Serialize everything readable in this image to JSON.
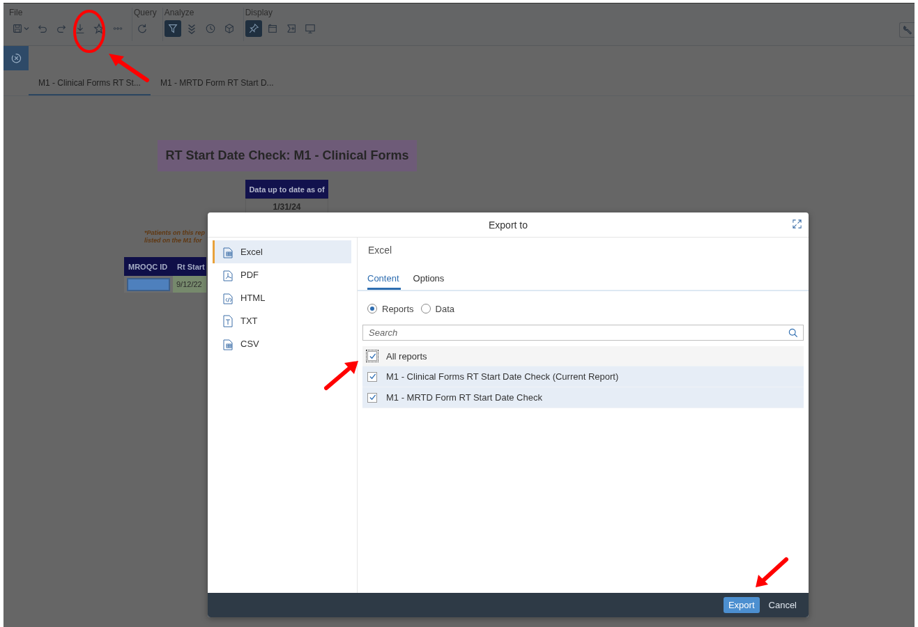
{
  "toolbar": {
    "groups": [
      {
        "label": "File",
        "buttons": [
          {
            "kind": "save",
            "on": false
          },
          {
            "kind": "undo",
            "on": false
          },
          {
            "kind": "redo",
            "on": false
          },
          {
            "kind": "download",
            "on": false
          },
          {
            "kind": "star",
            "on": false
          },
          {
            "kind": "more",
            "on": false
          }
        ]
      },
      {
        "label": "Query",
        "buttons": [
          {
            "kind": "refresh",
            "on": false
          }
        ]
      },
      {
        "label": "Analyze",
        "buttons": [
          {
            "kind": "filter",
            "on": true
          },
          {
            "kind": "chevrons",
            "on": false
          },
          {
            "kind": "history",
            "on": false
          },
          {
            "kind": "cube",
            "on": false
          }
        ]
      },
      {
        "label": "Display",
        "buttons": [
          {
            "kind": "pin",
            "on": true
          },
          {
            "kind": "window",
            "on": false
          },
          {
            "kind": "insert",
            "on": false
          },
          {
            "kind": "monitor",
            "on": false
          }
        ]
      }
    ]
  },
  "tabs": [
    {
      "label": "M1 - Clinical Forms RT St...",
      "selected": true
    },
    {
      "label": "M1 - MRTD Form RT Start D...",
      "selected": false
    }
  ],
  "report": {
    "title": "RT Start Date Check: M1 - Clinical Forms",
    "date_header": "Data up to date as of",
    "date_value": "1/31/24",
    "note_lines": [
      "*Patients on this rep",
      "listed on the M1 for"
    ],
    "table": {
      "columns": [
        "MROQC ID",
        "Rt Start"
      ],
      "rows": [
        {
          "rt_start": "9/12/22"
        }
      ]
    }
  },
  "dialog": {
    "title": "Export to",
    "formats": [
      {
        "label": "Excel",
        "kind": "grid",
        "selected": true
      },
      {
        "label": "PDF",
        "kind": "pdf",
        "selected": false
      },
      {
        "label": "HTML",
        "kind": "code",
        "selected": false
      },
      {
        "label": "TXT",
        "kind": "text",
        "selected": false
      },
      {
        "label": "CSV",
        "kind": "grid",
        "selected": false
      }
    ],
    "panel_title": "Excel",
    "tabs": [
      {
        "label": "Content",
        "selected": true
      },
      {
        "label": "Options",
        "selected": false
      }
    ],
    "scope": [
      {
        "label": "Reports",
        "selected": true
      },
      {
        "label": "Data",
        "selected": false
      }
    ],
    "search": {
      "placeholder": "Search"
    },
    "reports": [
      {
        "label": "All reports",
        "kind": "all",
        "checked": true
      },
      {
        "label": "M1 - Clinical Forms RT Start Date Check (Current Report)",
        "kind": "item",
        "checked": true
      },
      {
        "label": "M1 - MRTD Form RT Start Date Check",
        "kind": "item",
        "checked": true
      }
    ],
    "buttons": [
      {
        "label": "Export",
        "kind": "primary"
      },
      {
        "label": "Cancel",
        "kind": "plain"
      }
    ]
  }
}
